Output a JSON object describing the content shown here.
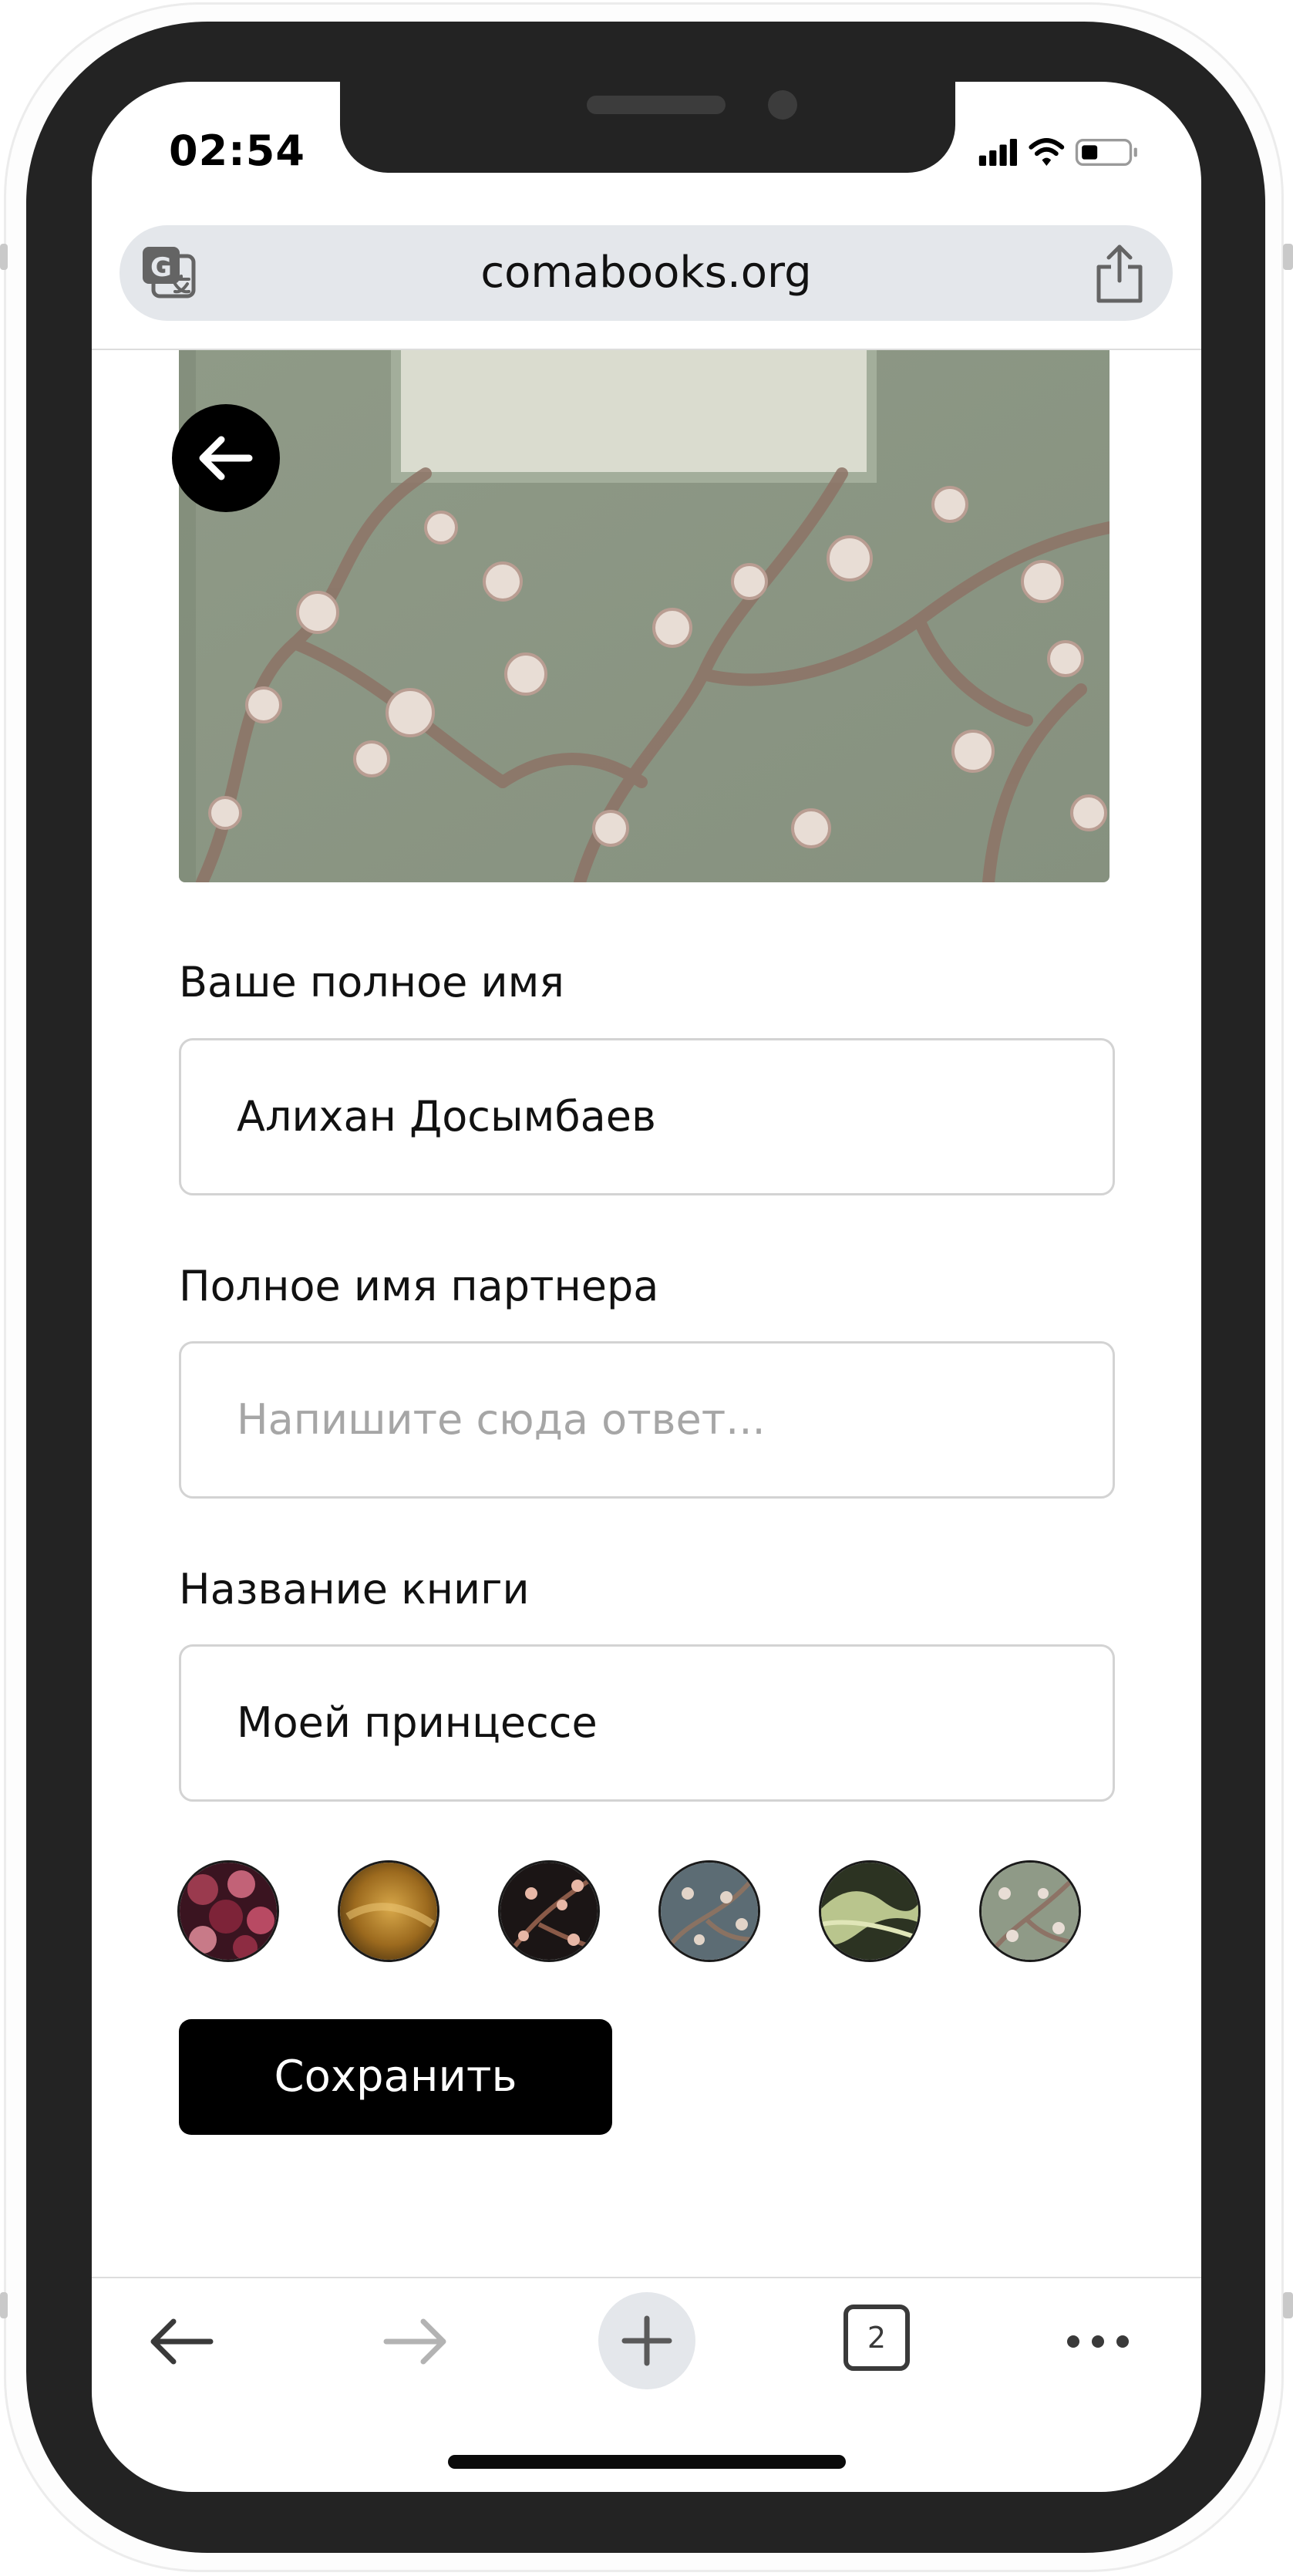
{
  "status_bar": {
    "time": "02:54"
  },
  "browser": {
    "url": "comabooks.org",
    "tab_count": "2",
    "icons": [
      "translate-icon",
      "share-icon",
      "back-arrow-icon",
      "forward-arrow-icon",
      "new-tab-plus-icon",
      "tabs-count-icon",
      "more-dots-icon"
    ]
  },
  "form": {
    "full_name": {
      "label": "Ваше полное имя",
      "value": "Алихан Досымбаев"
    },
    "partner_name": {
      "label": "Полное имя партнера",
      "placeholder": "Напишите сюда ответ..."
    },
    "book_title": {
      "label": "Название книги",
      "value": "Моей принцессе"
    },
    "save_label": "Сохранить"
  },
  "cover_swatches": [
    "dark-red-roses",
    "golden-amber",
    "black-blossom",
    "slate-blossom",
    "green-storm",
    "sage-blossom"
  ],
  "colors": {
    "accent": "#000000",
    "cover_base": "#8e9a87",
    "url_bar": "#e4e7eb"
  }
}
